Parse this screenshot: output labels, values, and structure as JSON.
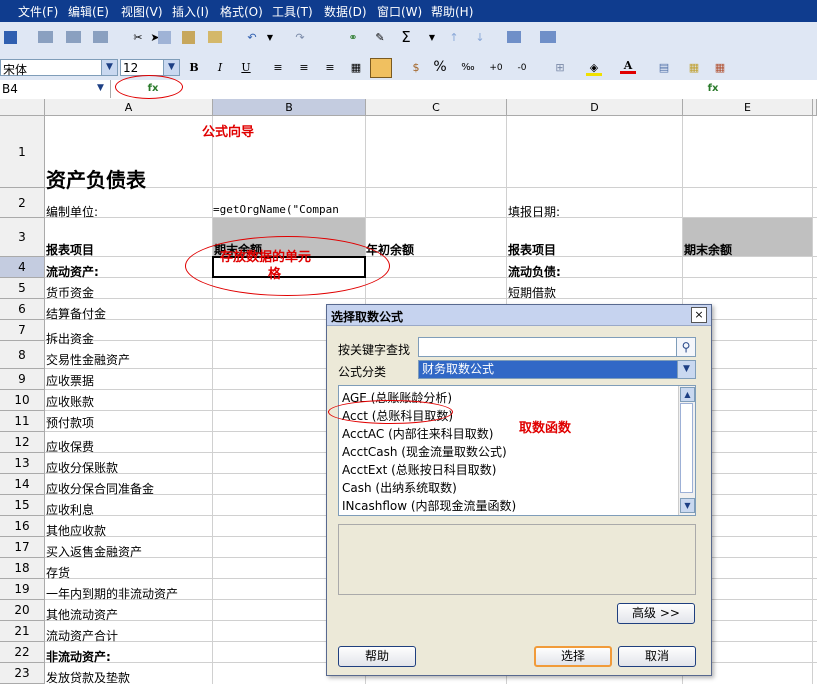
{
  "menu": [
    "文件(F)",
    "编辑(E)",
    "视图(V)",
    "插入(I)",
    "格式(O)",
    "工具(T)",
    "数据(D)",
    "窗口(W)",
    "帮助(H)"
  ],
  "format_bar": {
    "font": "宋体",
    "size": "12",
    "percent": "%",
    "permille": "‰"
  },
  "name_box": "B4",
  "columns": [
    "A",
    "B",
    "C",
    "D",
    "E"
  ],
  "rows": [
    "1",
    "2",
    "3",
    "4",
    "5",
    "6",
    "7",
    "8",
    "9",
    "10",
    "11",
    "12",
    "13",
    "14",
    "15",
    "16",
    "17",
    "18",
    "19",
    "20",
    "21",
    "22",
    "23"
  ],
  "sheet": {
    "title": "资产负债表",
    "unit_label": "编制单位:",
    "formula_text": "=getOrgName(\"Compan",
    "date_label": "填报日期:",
    "header_item": "报表项目",
    "header_end": "期末余额",
    "header_begin": "年初余额",
    "header_item2": "报表项目",
    "header_end2": "期末余额",
    "col_a_items": [
      "流动资产:",
      "货币资金",
      "结算备付金",
      "拆出资金",
      "交易性金融资产",
      "应收票据",
      "应收账款",
      "预付款项",
      "应收保费",
      "应收分保账款",
      "应收分保合同准备金",
      "应收利息",
      "其他应收款",
      "买入返售金融资产",
      "存货",
      "一年内到期的非流动资产",
      "其他流动资产",
      "流动资产合计",
      "非流动资产:",
      "发放贷款及垫款"
    ],
    "d4": "流动负债:",
    "d5": "短期借款"
  },
  "annotations": {
    "formula_wizard": "公式向导",
    "fetch_cell_1": "存放数据的单元",
    "fetch_cell_2": "格",
    "fetch_function": "取数函数"
  },
  "dialog": {
    "title": "选择取数公式",
    "close": "×",
    "search_label": "按关键字查找",
    "search_value": "",
    "category_label": "公式分类",
    "category_value": "财务取数公式",
    "functions": [
      "AGE (总账账龄分析)",
      "Acct (总账科目取数)",
      "AcctAC (内部往来科目取数)",
      "AcctCash (现金流量取数公式)",
      "AcctExt (总账按日科目取数)",
      "Cash (出纳系统取数)",
      "INcashflow (内部现金流量函数)"
    ],
    "advanced": "高级 >>",
    "help": "帮助",
    "select": "选择",
    "cancel": "取消"
  },
  "colors": {
    "menubar": "#0f3c8e",
    "annotation": "#e00000",
    "category_highlight": "#3168c6"
  }
}
